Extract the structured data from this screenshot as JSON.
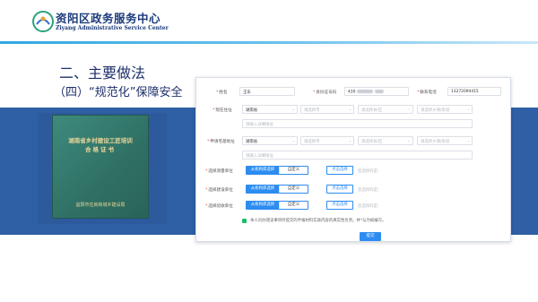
{
  "header": {
    "brand_cn": "资阳区政务服务中心",
    "brand_en": "Ziyang Administrative Service Center",
    "accent": "#2fa8e0"
  },
  "slide": {
    "title": "二、主要做法",
    "subtitle": "（四）“规范化”保障安全",
    "band_color": "#2f5fa4"
  },
  "certificate": {
    "title_line1": "湖南省乡村建设工匠培训",
    "title_line2": "合格证书",
    "issuer": "益阳市住房和城乡建设局"
  },
  "form": {
    "name_label": "姓名",
    "name_value": "王乐",
    "id_label": "身份证号码",
    "id_value": "430",
    "phone_label": "联系电话",
    "phone_value": "13272094415",
    "current_addr_label": "现在住址",
    "current_addr_province": "湖南省",
    "current_addr_city": "请选择市",
    "current_addr_county": "请选择县/区",
    "current_addr_town": "请选择乡镇/街道",
    "current_addr_detail": "请输入详细地址",
    "apply_addr_label": "申请宅基地址",
    "apply_addr_province": "湖南省",
    "apply_addr_city": "请选择市",
    "apply_addr_county": "请选择县/区",
    "apply_addr_town": "请选择乡镇/街道",
    "apply_addr_detail": "请输入详细地址",
    "survey_unit_label": "选择测量单位",
    "build_unit_label": "选择建设单位",
    "accept_unit_label": "选择验收单位",
    "seg_list": "从机构库选择",
    "seg_custom": "自定义",
    "pick_button": "点击选择",
    "pick_hint": "您选择的是：",
    "agree_text": "本人对办理该事项所提交的申报材料实质内容的真实性负责。并*与为如编写。",
    "submit_label": "提交",
    "primary_color": "#2d8cf0",
    "required_color": "#e0403a",
    "check_color": "#19be6b"
  }
}
